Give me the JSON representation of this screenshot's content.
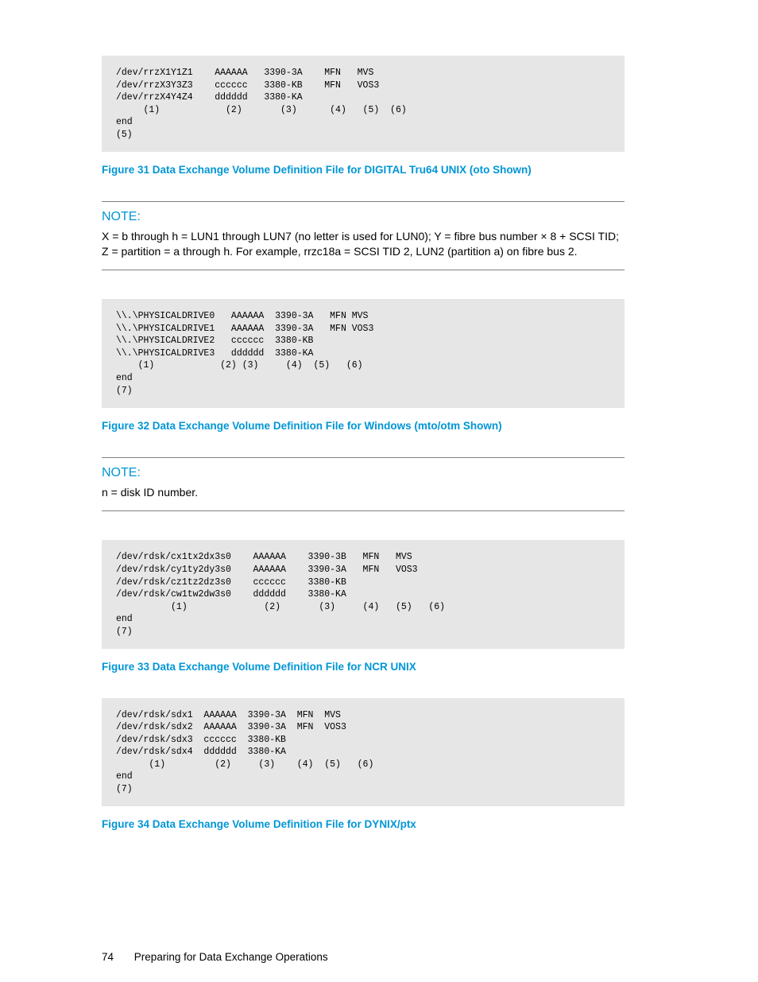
{
  "code1": "/dev/rrzX1Y1Z1    AAAAAA   3390-3A    MFN   MVS\n/dev/rrzX3Y3Z3    cccccc   3380-KB    MFN   VOS3\n/dev/rrzX4Y4Z4    dddddd   3380-KA\n     (1)            (2)       (3)      (4)   (5)  (6)\nend\n(5)",
  "caption1": "Figure 31 Data Exchange Volume Definition File for DIGITAL Tru64 UNIX (oto Shown)",
  "note1_label": "NOTE:",
  "note1_body": "X = b through h = LUN1 through LUN7 (no letter is used for LUN0); Y = fibre bus number × 8 + SCSI TID; Z = partition = a through h. For example, rrzc18a = SCSI TID 2, LUN2 (partition a) on fibre bus 2.",
  "code2": "\\\\.\\PHYSICALDRIVE0   AAAAAA  3390-3A   MFN MVS\n\\\\.\\PHYSICALDRIVE1   AAAAAA  3390-3A   MFN VOS3\n\\\\.\\PHYSICALDRIVE2   cccccc  3380-KB\n\\\\.\\PHYSICALDRIVE3   dddddd  3380-KA\n    (1)            (2) (3)     (4)  (5)   (6)\nend\n(7)",
  "caption2": "Figure 32 Data Exchange Volume Definition File for Windows (mto/otm Shown)",
  "note2_label": "NOTE:",
  "note2_body": "n = disk ID number.",
  "code3": "/dev/rdsk/cx1tx2dx3s0    AAAAAA    3390-3B   MFN   MVS\n/dev/rdsk/cy1ty2dy3s0    AAAAAA    3390-3A   MFN   VOS3\n/dev/rdsk/cz1tz2dz3s0    cccccc    3380-KB\n/dev/rdsk/cw1tw2dw3s0    dddddd    3380-KA\n          (1)              (2)       (3)     (4)   (5)   (6)\nend\n(7)",
  "caption3": "Figure 33 Data Exchange Volume Definition File for NCR UNIX",
  "code4": "/dev/rdsk/sdx1  AAAAAA  3390-3A  MFN  MVS\n/dev/rdsk/sdx2  AAAAAA  3390-3A  MFN  VOS3\n/dev/rdsk/sdx3  cccccc  3380-KB\n/dev/rdsk/sdx4  dddddd  3380-KA\n      (1)         (2)     (3)    (4)  (5)   (6)\nend\n(7)",
  "caption4": "Figure 34 Data Exchange Volume Definition File for DYNIX/ptx",
  "footer_page": "74",
  "footer_title": "Preparing for Data Exchange Operations"
}
